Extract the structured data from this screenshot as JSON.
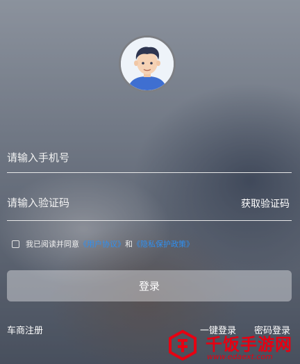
{
  "form": {
    "phone_placeholder": "请输入手机号",
    "code_placeholder": "请输入验证码",
    "get_code_label": "获取验证码"
  },
  "agreement": {
    "prefix": "我已阅读并同意",
    "user_agreement": "《用户协议》",
    "conjunction": "和",
    "privacy_policy": "《隐私保护政策》",
    "link_color": "#2f8ff0"
  },
  "login_button_label": "登录",
  "bottom_links": {
    "dealer_register": "车商注册",
    "one_click_login": "一键登录",
    "password_login": "密码登录"
  },
  "watermark": {
    "brand": "千饭手游网",
    "url": "www.edaext.com",
    "color": "#e60012"
  },
  "icons": {
    "avatar": "user-avatar-icon",
    "checkbox": "checkbox-icon",
    "watermark_logo": "watermark-logo-icon"
  }
}
